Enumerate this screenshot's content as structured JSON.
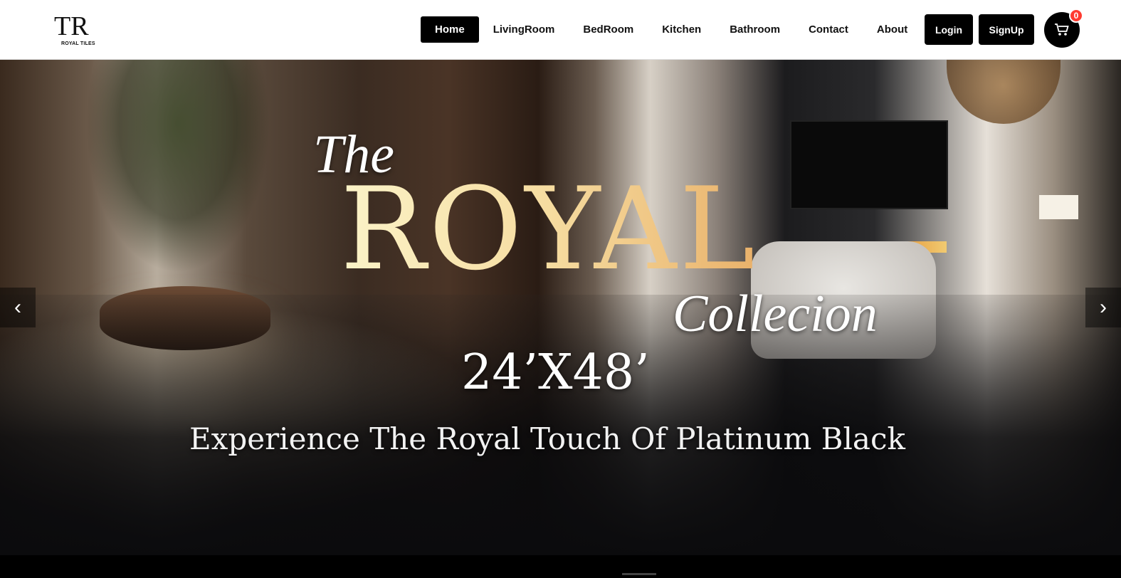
{
  "brand": {
    "mark": "TR",
    "name": "ROYAL TILES"
  },
  "nav": {
    "items": [
      {
        "label": "Home",
        "active": true
      },
      {
        "label": "LivingRoom",
        "active": false
      },
      {
        "label": "BedRoom",
        "active": false
      },
      {
        "label": "Kitchen",
        "active": false
      },
      {
        "label": "Bathroom",
        "active": false
      },
      {
        "label": "Contact",
        "active": false
      },
      {
        "label": "About",
        "active": false
      }
    ],
    "login_label": "Login",
    "signup_label": "SignUp",
    "cart_count": "0",
    "cart_icon": "cart-icon"
  },
  "hero": {
    "line_the": "The",
    "line_royal": "ROYAL",
    "line_collection": "Collecion",
    "size": "24’X48’",
    "tagline": "Experience The Royal Touch Of Platinum Black",
    "prev_label": "‹",
    "next_label": "›"
  },
  "colors": {
    "accent": "#000000",
    "badge": "#ff3b30",
    "gold_start": "#fbf3c8",
    "gold_end": "#e9b16a"
  }
}
